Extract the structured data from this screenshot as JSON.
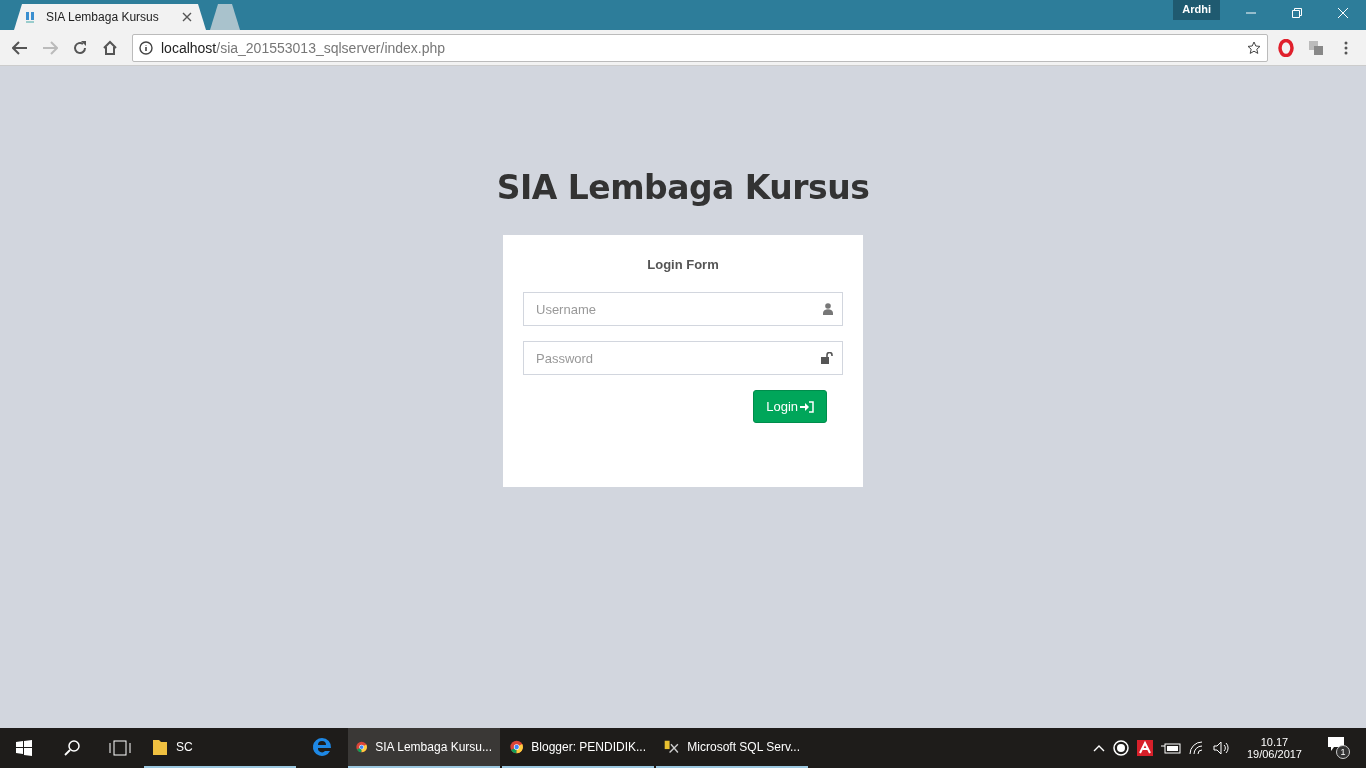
{
  "browser": {
    "tabs": [
      {
        "title": "SIA Lembaga Kursus",
        "selected": true
      },
      {
        "selected": false
      }
    ],
    "profile": "Ardhi",
    "address": {
      "host": "localhost",
      "path": "/sia_201553013_sqlserver/index.php"
    }
  },
  "page": {
    "title": "SIA Lembaga Kursus",
    "form": {
      "title": "Login Form",
      "fields": [
        {
          "placeholder": "Username",
          "kind": "user"
        },
        {
          "placeholder": "Password",
          "kind": "lock"
        }
      ],
      "button": "Login"
    }
  },
  "taskbar": {
    "apps": [
      {
        "label": "SC",
        "kind": "folder",
        "running": true,
        "selected": false
      },
      {
        "kind": "edge",
        "running": false,
        "selected": false
      },
      {
        "label": "SIA Lembaga Kursu...",
        "kind": "chrome",
        "running": true,
        "selected": true
      },
      {
        "label": "Blogger: PENDIDIK...",
        "kind": "chrome",
        "running": true,
        "selected": false
      },
      {
        "label": "Microsoft SQL Serv...",
        "kind": "sql",
        "running": true,
        "selected": false
      }
    ],
    "time": "10.17",
    "date": "19/06/2017",
    "notifications": "1"
  }
}
